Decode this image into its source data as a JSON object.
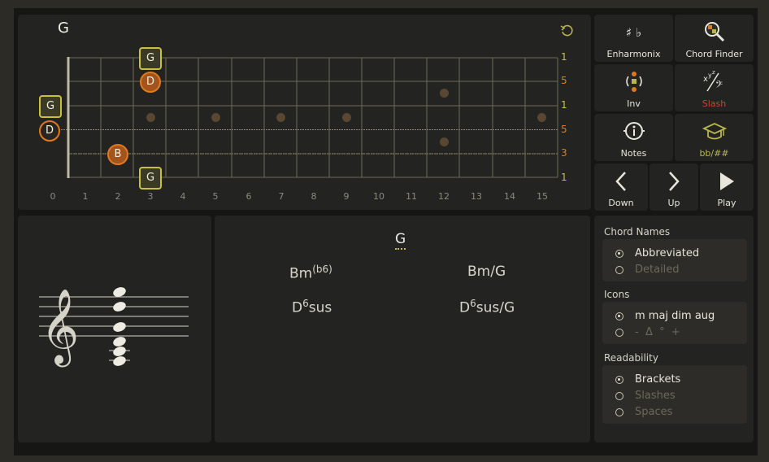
{
  "fretboard": {
    "title": "G",
    "fret_numbers": [
      "0",
      "1",
      "2",
      "3",
      "4",
      "5",
      "6",
      "7",
      "8",
      "9",
      "10",
      "11",
      "12",
      "13",
      "14",
      "15"
    ],
    "string_numbers": [
      "1",
      "5",
      "1",
      "5",
      "3",
      "1"
    ],
    "notes": {
      "s1_fret3": "G",
      "s2_fret3": "D",
      "s3_open": "G",
      "s4_open": "D",
      "s5_fret2": "B",
      "s6_fret3": "G"
    }
  },
  "toolbar": {
    "enharmonix": "Enharmonix",
    "sharp_flat": "♯ ♭",
    "chord_finder": "Chord Finder",
    "inv": "Inv",
    "slash": "Slash",
    "notes": "Notes",
    "bb_sharp": "bb/##",
    "down": "Down",
    "up": "Up",
    "play": "Play"
  },
  "chord_names": {
    "root": "G",
    "c1_main": "Bm",
    "c1_sup": "(b6)",
    "c2": "Bm/G",
    "c3_main": "D",
    "c3_sup": "6",
    "c3_rest": "sus",
    "c4_main": "D",
    "c4_sup": "6",
    "c4_rest": "sus/G"
  },
  "settings": {
    "chord_names_title": "Chord Names",
    "abbreviated": "Abbreviated",
    "detailed": "Detailed",
    "icons_title": "Icons",
    "icons_on": "m maj dim aug",
    "icons_off": "-  Δ  °  +",
    "readability_title": "Readability",
    "brackets": "Brackets",
    "slashes": "Slashes",
    "spaces": "Spaces"
  },
  "colors": {
    "accent_yellow": "#c9c13b",
    "accent_orange": "#e07a1e",
    "slash_red": "#d0432f",
    "bb_green": "#b9b64a"
  }
}
